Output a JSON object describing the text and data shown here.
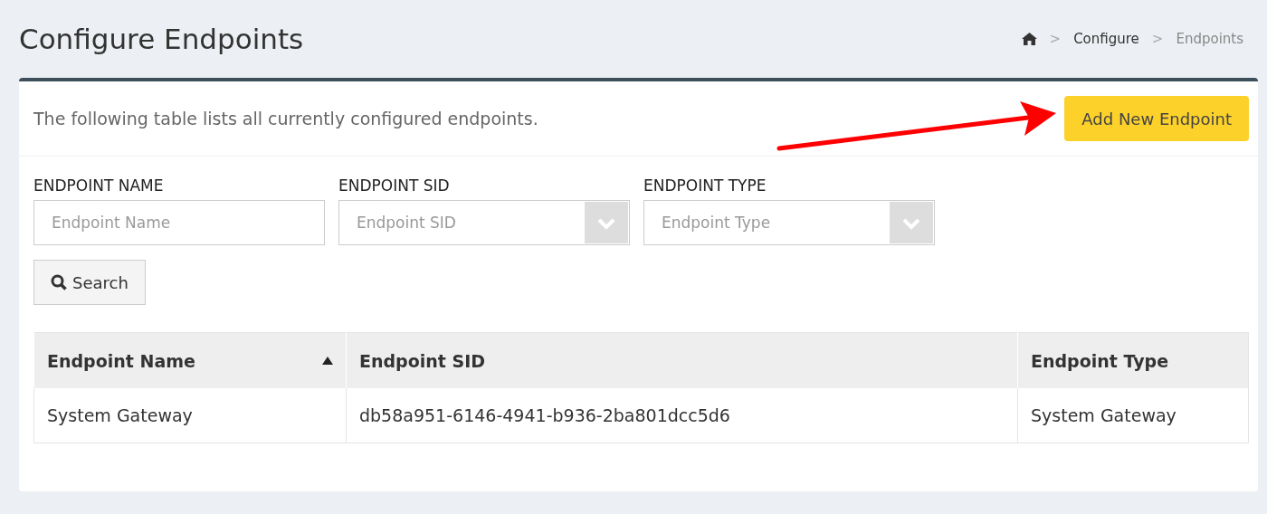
{
  "page_title": "Configure Endpoints",
  "breadcrumb": [
    {
      "label": "Configure",
      "current": false
    },
    {
      "label": "Endpoints",
      "current": true
    }
  ],
  "breadcrumb_separator": ">",
  "panel": {
    "description": "The following table lists all currently configured endpoints.",
    "add_button": "Add New Endpoint"
  },
  "filters": [
    {
      "kind": "text",
      "label": "ENDPOINT NAME",
      "placeholder": "Endpoint Name"
    },
    {
      "kind": "select",
      "label": "ENDPOINT SID",
      "placeholder": "Endpoint SID"
    },
    {
      "kind": "select",
      "label": "ENDPOINT TYPE",
      "placeholder": "Endpoint Type"
    }
  ],
  "search_button": "Search",
  "table": {
    "columns": [
      {
        "label": "Endpoint Name",
        "sorted": true
      },
      {
        "label": "Endpoint SID",
        "sorted": false
      },
      {
        "label": "Endpoint Type",
        "sorted": false
      }
    ],
    "rows": [
      [
        "System Gateway",
        "db58a951-6146-4941-b936-2ba801dcc5d6",
        "System Gateway"
      ]
    ]
  }
}
